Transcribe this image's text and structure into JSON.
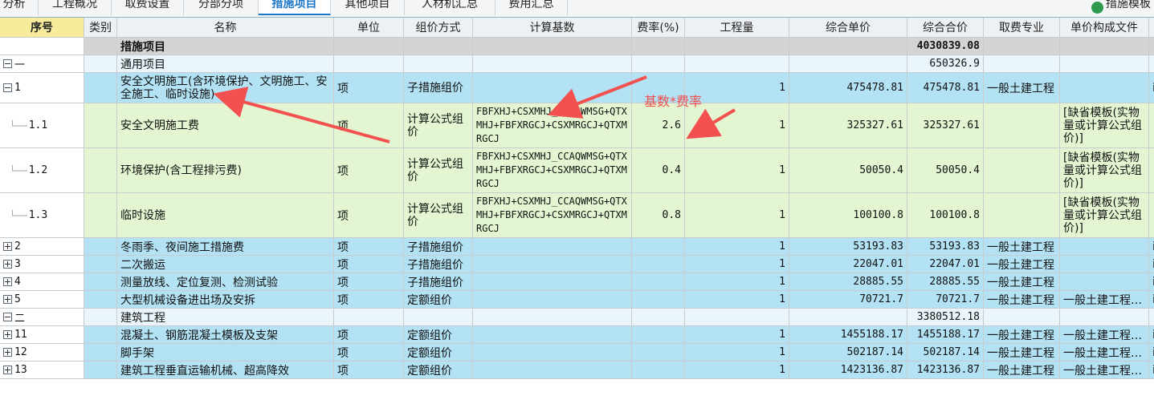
{
  "tabs": [
    {
      "label": "分析",
      "active": false
    },
    {
      "label": "工程概况",
      "active": false
    },
    {
      "label": "取费设置",
      "active": false
    },
    {
      "label": "分部分项",
      "active": false
    },
    {
      "label": "措施项目",
      "active": true
    },
    {
      "label": "其他项目",
      "active": false
    },
    {
      "label": "人材机汇总",
      "active": false
    },
    {
      "label": "费用汇总",
      "active": false
    }
  ],
  "toolbar_right": {
    "template_label": "措施模板"
  },
  "columns": {
    "seq": "序号",
    "category": "类别",
    "name": "名称",
    "unit": "单位",
    "pricing_method": "组价方式",
    "calc_base": "计算基数",
    "rate": "费率(%)",
    "quantity": "工程量",
    "unit_price": "综合单价",
    "total_price": "综合合价",
    "fee_specialty": "取费专业",
    "price_file": "单价构成文件"
  },
  "rows": [
    {
      "type": "title",
      "seq": "",
      "name": "措施项目",
      "unit": "",
      "method": "",
      "base": "",
      "rate": "",
      "qty": "",
      "unit_price": "",
      "total": "4030839.08",
      "specialty": "",
      "file": "",
      "edge": ""
    },
    {
      "type": "section",
      "seq": "一",
      "expander": "minus",
      "name": "通用项目",
      "unit": "",
      "method": "",
      "base": "",
      "rate": "",
      "qty": "",
      "unit_price": "",
      "total": "650326.9",
      "specialty": "",
      "file": "",
      "edge": ""
    },
    {
      "type": "blue",
      "seq": "1",
      "expander": "minus",
      "name": "安全文明施工(含环境保护、文明施工、安全施工、临时设施)",
      "unit": "项",
      "method": "子措施组价",
      "base": "",
      "rate": "",
      "qty": "1",
      "unit_price": "475478.81",
      "total": "475478.81",
      "specialty": "一般土建工程",
      "file": "",
      "edge": "i"
    },
    {
      "type": "green",
      "seq": "1.1",
      "tree": true,
      "name": "安全文明施工费",
      "unit": "项",
      "method": "计算公式组价",
      "base": "FBFXHJ+CSXMHJ_CCAQWMSG+QTXMHJ+FBFXRGCJ+CSXMRGCJ+QTXMRGCJ",
      "rate": "2.6",
      "qty": "1",
      "unit_price": "325327.61",
      "total": "325327.61",
      "specialty": "",
      "file": "[缺省模板(实物量或计算公式组价)]",
      "edge": ""
    },
    {
      "type": "green",
      "seq": "1.2",
      "tree": true,
      "name": "环境保护(含工程排污费)",
      "unit": "项",
      "method": "计算公式组价",
      "base": "FBFXHJ+CSXMHJ_CCAQWMSG+QTXMHJ+FBFXRGCJ+CSXMRGCJ+QTXMRGCJ",
      "rate": "0.4",
      "qty": "1",
      "unit_price": "50050.4",
      "total": "50050.4",
      "specialty": "",
      "file": "[缺省模板(实物量或计算公式组价)]",
      "edge": ""
    },
    {
      "type": "green",
      "seq": "1.3",
      "tree": true,
      "name": "临时设施",
      "unit": "项",
      "method": "计算公式组价",
      "base": "FBFXHJ+CSXMHJ_CCAQWMSG+QTXMHJ+FBFXRGCJ+CSXMRGCJ+QTXMRGCJ",
      "rate": "0.8",
      "qty": "1",
      "unit_price": "100100.8",
      "total": "100100.8",
      "specialty": "",
      "file": "[缺省模板(实物量或计算公式组价)]",
      "edge": ""
    },
    {
      "type": "blue",
      "seq": "2",
      "expander": "plus",
      "name": "冬雨季、夜间施工措施费",
      "unit": "项",
      "method": "子措施组价",
      "base": "",
      "rate": "",
      "qty": "1",
      "unit_price": "53193.83",
      "total": "53193.83",
      "specialty": "一般土建工程",
      "file": "",
      "edge": "i"
    },
    {
      "type": "blue",
      "seq": "3",
      "expander": "plus",
      "name": "二次搬运",
      "unit": "项",
      "method": "子措施组价",
      "base": "",
      "rate": "",
      "qty": "1",
      "unit_price": "22047.01",
      "total": "22047.01",
      "specialty": "一般土建工程",
      "file": "",
      "edge": "i"
    },
    {
      "type": "blue",
      "seq": "4",
      "expander": "plus",
      "name": "测量放线、定位复测、检测试验",
      "unit": "项",
      "method": "子措施组价",
      "base": "",
      "rate": "",
      "qty": "1",
      "unit_price": "28885.55",
      "total": "28885.55",
      "specialty": "一般土建工程",
      "file": "",
      "edge": "i"
    },
    {
      "type": "blue",
      "seq": "5",
      "expander": "plus",
      "name": "大型机械设备进出场及安拆",
      "unit": "项",
      "method": "定额组价",
      "base": "",
      "rate": "",
      "qty": "1",
      "unit_price": "70721.7",
      "total": "70721.7",
      "specialty": "一般土建工程",
      "file": "一般土建工程…",
      "edge": "i"
    },
    {
      "type": "section",
      "seq": "二",
      "expander": "minus",
      "name": "建筑工程",
      "unit": "",
      "method": "",
      "base": "",
      "rate": "",
      "qty": "",
      "unit_price": "",
      "total": "3380512.18",
      "specialty": "",
      "file": "",
      "edge": ""
    },
    {
      "type": "blue",
      "seq": "11",
      "expander": "plus",
      "name": "混凝土、钢筋混凝土模板及支架",
      "unit": "项",
      "method": "定额组价",
      "base": "",
      "rate": "",
      "qty": "1",
      "unit_price": "1455188.17",
      "total": "1455188.17",
      "specialty": "一般土建工程",
      "file": "一般土建工程…",
      "edge": "i"
    },
    {
      "type": "blue",
      "seq": "12",
      "expander": "plus",
      "name": "脚手架",
      "unit": "项",
      "method": "定额组价",
      "base": "",
      "rate": "",
      "qty": "1",
      "unit_price": "502187.14",
      "total": "502187.14",
      "specialty": "一般土建工程",
      "file": "一般土建工程…",
      "edge": "i"
    },
    {
      "type": "blue",
      "seq": "13",
      "expander": "plus",
      "name": "建筑工程垂直运输机械、超高降效",
      "unit": "项",
      "method": "定额组价",
      "base": "",
      "rate": "",
      "qty": "1",
      "unit_price": "1423136.87",
      "total": "1423136.87",
      "specialty": "一般土建工程",
      "file": "一般土建工程…",
      "edge": "i"
    }
  ],
  "annotation": {
    "text": "基数*费率",
    "color": "#f2514f"
  }
}
